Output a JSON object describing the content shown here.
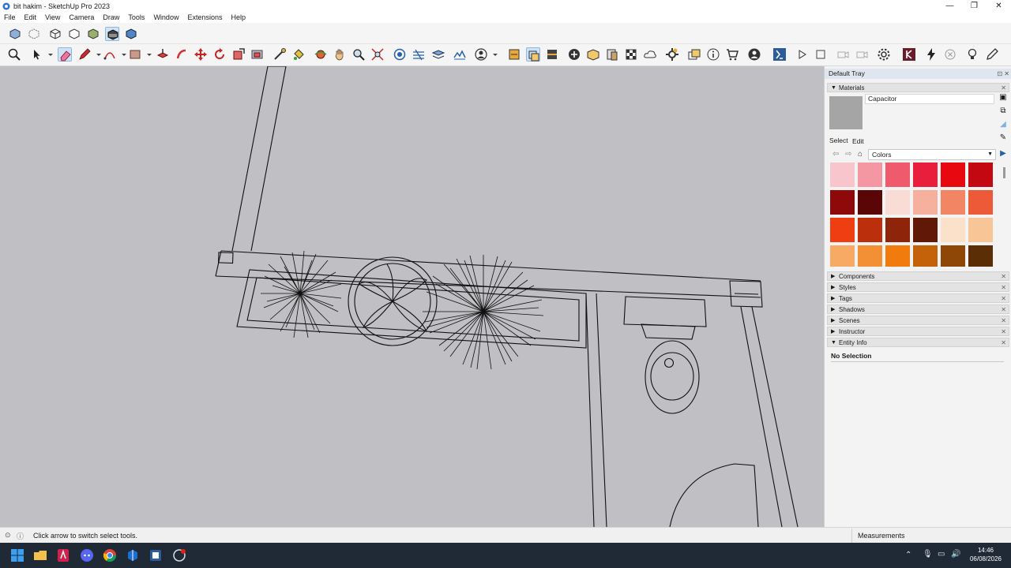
{
  "window": {
    "title": "bit hakim - SketchUp Pro 2023",
    "minimize": "—",
    "maximize": "❐",
    "close": "✕"
  },
  "menu": [
    "File",
    "Edit",
    "View",
    "Camera",
    "Draw",
    "Tools",
    "Window",
    "Extensions",
    "Help"
  ],
  "tray": {
    "title": "Default Tray",
    "materials": {
      "label": "Materials",
      "current_name": "Capacitor",
      "preview_color": "#a5a5a5",
      "tabs": [
        "Select",
        "Edit"
      ],
      "library": "Colors",
      "swatches": [
        "#f7c5cb",
        "#f497a3",
        "#ef5b6c",
        "#e91e3c",
        "#e8080f",
        "#c40812",
        "#8e0a0a",
        "#5a0606",
        "#f9dcd5",
        "#f5b09e",
        "#f28564",
        "#ed5a38",
        "#ef3f12",
        "#bc2f0d",
        "#8e2409",
        "#601807",
        "#fbe1c9",
        "#f8c597",
        "#f6aa63",
        "#f39035",
        "#f17c0d",
        "#c4620a",
        "#8e4707",
        "#5b2e05"
      ]
    },
    "panels": [
      "Components",
      "Styles",
      "Tags",
      "Shadows",
      "Scenes",
      "Instructor",
      "Entity Info"
    ],
    "entity_info": "No Selection"
  },
  "status": {
    "hint": "Click arrow to switch select tools.",
    "measurements_label": "Measurements"
  },
  "clock": {
    "time": "14:46",
    "date": "06/08/2026"
  }
}
